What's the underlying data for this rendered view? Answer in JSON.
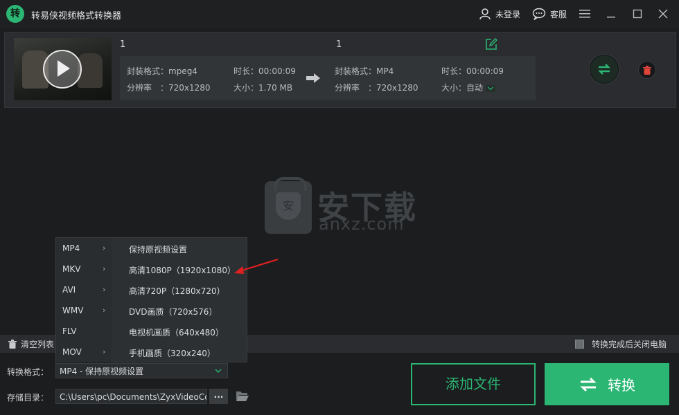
{
  "app": {
    "logo_text": "转",
    "title": "转易侠视频格式转换器"
  },
  "header": {
    "login_label": "未登录",
    "service_label": "客服"
  },
  "file": {
    "source_name": "1",
    "target_name": "1",
    "source": {
      "format": "封装格式：mpeg4",
      "duration": "时长：00:00:09",
      "resolution": "分辨率　：720x1280",
      "size": "大小：1.70 MB"
    },
    "target": {
      "format": "封装格式：MP4",
      "duration": "时长：00:00:09",
      "resolution": "分辨率　：720x1280",
      "size": "大小：自动"
    }
  },
  "watermark": {
    "badge": "安",
    "main": "安下载",
    "sub": "anxz.com"
  },
  "dropdown": {
    "rows": [
      {
        "format": "MP4",
        "chevron": "›",
        "option": "保持原视频设置"
      },
      {
        "format": "MKV",
        "chevron": "›",
        "option": "高清1080P（1920x1080）"
      },
      {
        "format": "AVI",
        "chevron": "›",
        "option": "高清720P（1280x720）"
      },
      {
        "format": "WMV",
        "chevron": "›",
        "option": "DVD画质（720x576）"
      },
      {
        "format": "FLV",
        "chevron": "",
        "option": "电视机画质（640x480）"
      },
      {
        "format": "MOV",
        "chevron": "›",
        "option": "手机画质（320x240）"
      }
    ]
  },
  "bottom": {
    "clear_label": "清空列表",
    "shutdown_label": "转换完成后关闭电脑",
    "format_label": "转换格式：",
    "format_value": "MP4 - 保持原视频设置",
    "dir_label": "存储目录：",
    "dir_value": "C:\\Users\\pc\\Documents\\ZyxVideoConverter",
    "dir_more": "...",
    "add_button": "添加文件",
    "convert_button": "转换"
  },
  "colors": {
    "accent": "#2bb673",
    "background": "#1b1d1f",
    "delete": "#e0443a",
    "annotation": "#e02020"
  }
}
